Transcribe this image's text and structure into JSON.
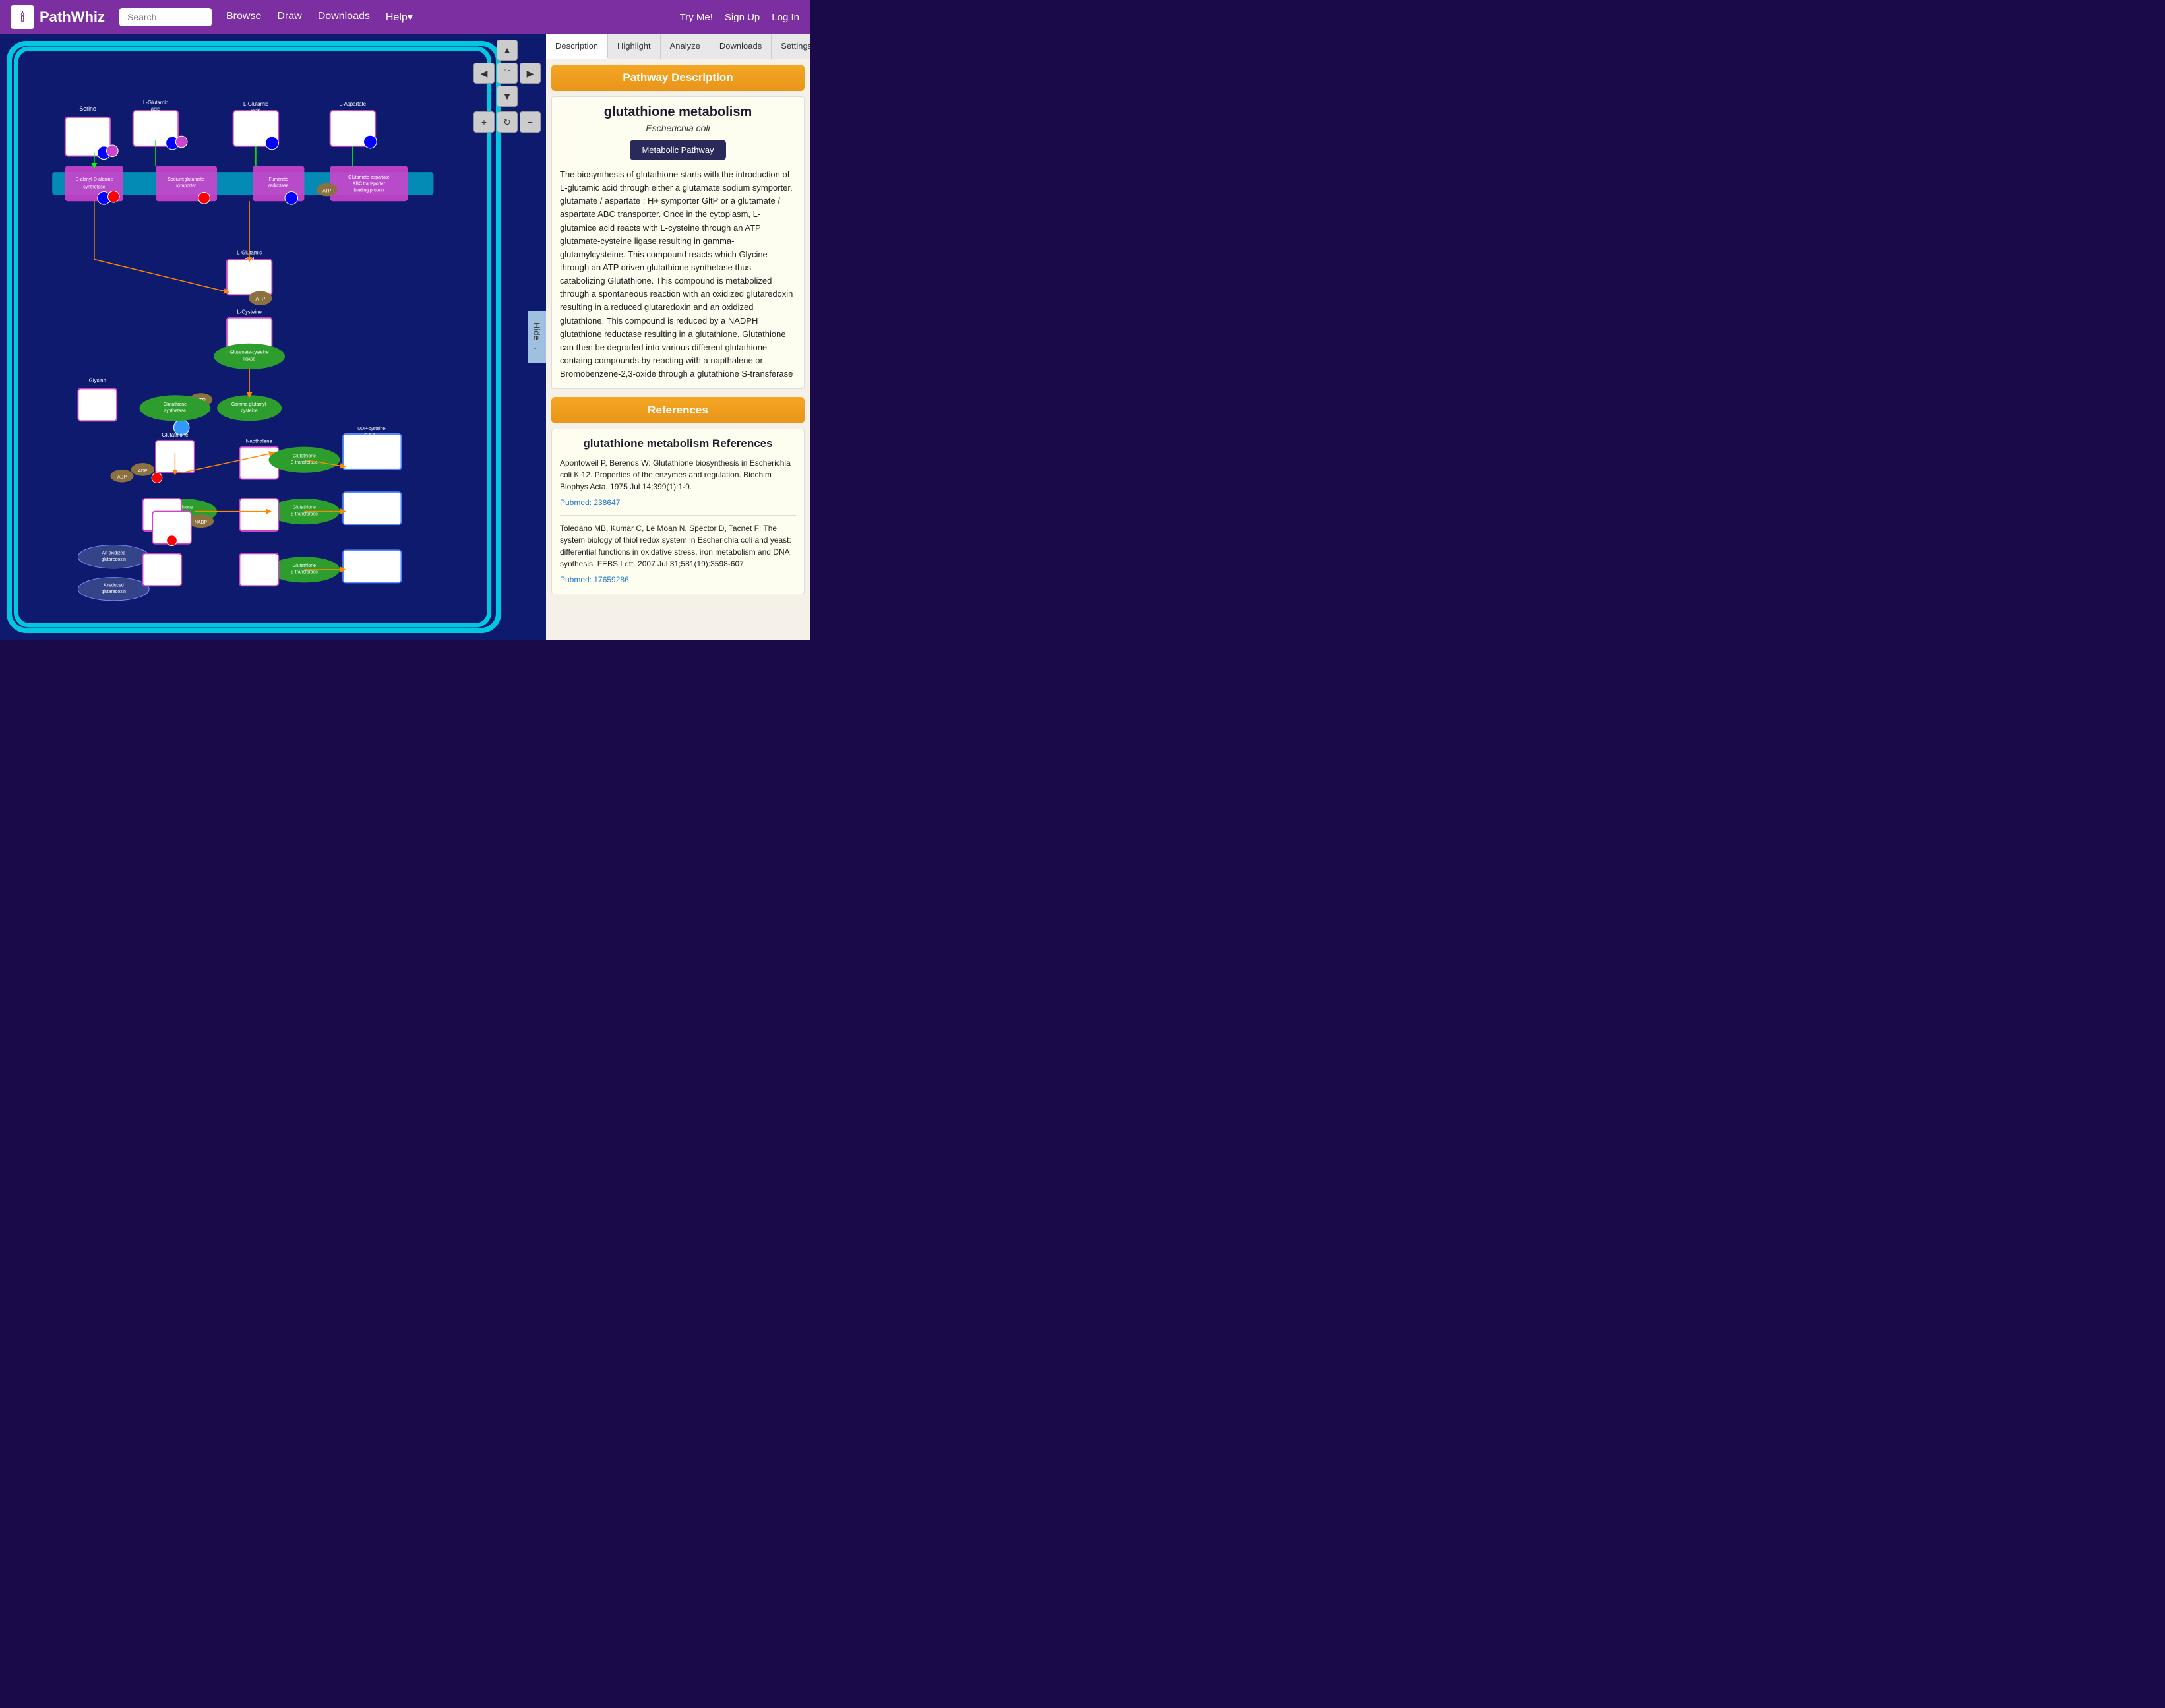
{
  "header": {
    "logo_text": "PathWhiz",
    "search_placeholder": "Search",
    "nav_items": [
      "Browse",
      "Draw",
      "Downloads",
      "Help▾"
    ],
    "nav_right": [
      "Try Me!",
      "Sign Up",
      "Log In"
    ]
  },
  "tabs": [
    {
      "label": "Description",
      "active": true
    },
    {
      "label": "Highlight",
      "active": false
    },
    {
      "label": "Analyze",
      "active": false
    },
    {
      "label": "Downloads",
      "active": false
    },
    {
      "label": "Settings",
      "active": false
    }
  ],
  "pathway_description": {
    "section_title": "Pathway Description",
    "title": "glutathione metabolism",
    "organism": "Escherichia coli",
    "type_button": "Metabolic Pathway",
    "description": "The biosynthesis of glutathione starts with the introduction of L-glutamic acid through either a glutamate:sodium symporter, glutamate / aspartate : H+ symporter GltP or a glutamate / aspartate ABC transporter. Once in the cytoplasm, L-glutamice acid reacts with L-cysteine through an ATP glutamate-cysteine ligase resulting in gamma-glutamylcysteine. This compound reacts which Glycine through an ATP driven glutathione synthetase thus catabolizing Glutathione. This compound is metabolized through a spontaneous reaction with an oxidized glutaredoxin resulting in a reduced glutaredoxin and an oxidized glutathione. This compound is reduced by a NADPH glutathione reductase resulting in a glutathione. Glutathione can then be degraded into various different glutathione containg compounds by reacting with a napthalene or Bromobenzene-2,3-oxide through a glutathione S-transferase"
  },
  "references": {
    "section_title": "References",
    "title": "glutathione metabolism References",
    "items": [
      {
        "text": "Apontoweil P, Berends W: Glutathione biosynthesis in Escherichia coli K 12. Properties of the enzymes and regulation. Biochim Biophys Acta. 1975 Jul 14;399(1):1-9.",
        "pubmed_label": "Pubmed: 238647",
        "pubmed_url": "#"
      },
      {
        "text": "Toledano MB, Kumar C, Le Moan N, Spector D, Tacnet F: The system biology of thiol redox system in Escherichia coli and yeast: differential functions in oxidative stress, iron metabolism and DNA synthesis. FEBS Lett. 2007 Jul 31;581(19):3598-607.",
        "pubmed_label": "Pubmed: 17659286",
        "pubmed_url": "#"
      }
    ]
  },
  "controls": {
    "up": "▲",
    "left": "◀",
    "center": "⛶",
    "right": "▶",
    "down": "▼",
    "zoom_in": "+",
    "refresh": "↻",
    "zoom_out": "−",
    "hide": "Hide →"
  }
}
